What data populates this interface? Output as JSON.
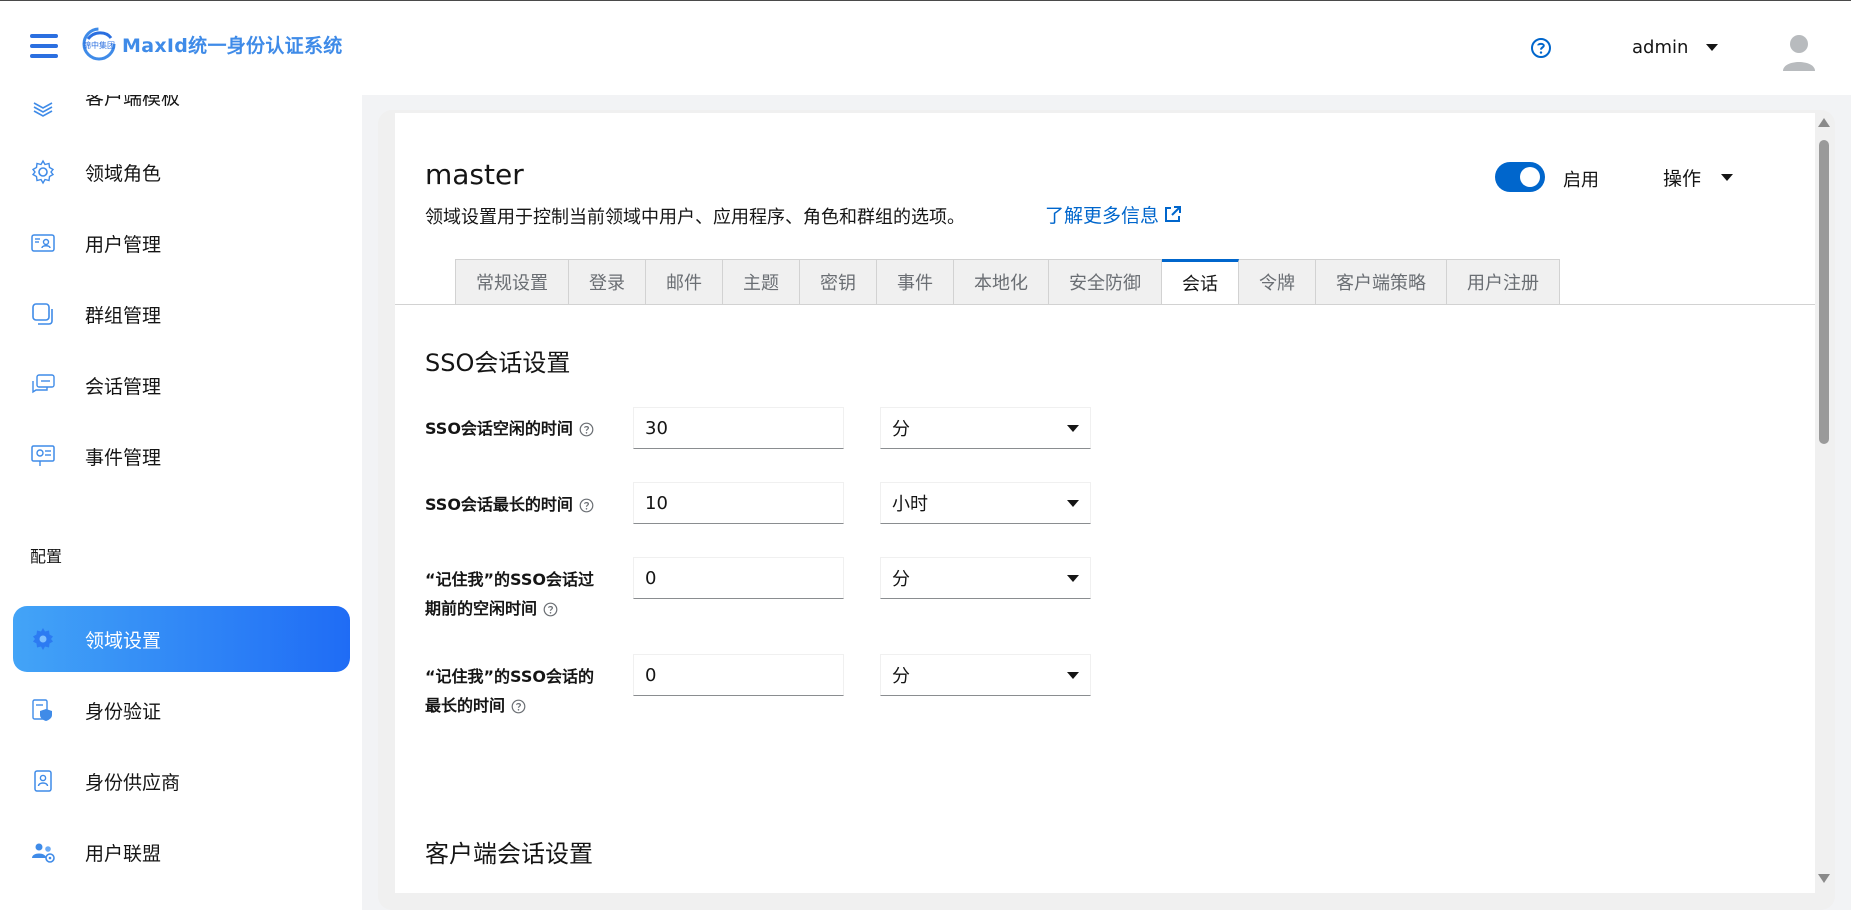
{
  "header": {
    "brand_mark": "锦中集团",
    "brand_title": "MaxId统一身份认证系统",
    "user_name": "admin"
  },
  "sidebar": {
    "items": [
      {
        "label": "客户端模板",
        "icon": "layers-icon"
      },
      {
        "label": "领域角色",
        "icon": "gear-icon"
      },
      {
        "label": "用户管理",
        "icon": "id-card-icon"
      },
      {
        "label": "群组管理",
        "icon": "copy-icon"
      },
      {
        "label": "会话管理",
        "icon": "chat-icon"
      },
      {
        "label": "事件管理",
        "icon": "monitor-icon"
      }
    ],
    "section_label": "配置",
    "config_items": [
      {
        "label": "领域设置",
        "icon": "gear-icon",
        "active": true
      },
      {
        "label": "身份验证",
        "icon": "shield-icon"
      },
      {
        "label": "身份供应商",
        "icon": "badge-icon"
      },
      {
        "label": "用户联盟",
        "icon": "users-icon"
      }
    ]
  },
  "realm": {
    "title": "master",
    "description": "领域设置用于控制当前领域中用户、应用程序、角色和群组的选项。",
    "learn_more": "了解更多信息",
    "enabled_label": "启用",
    "enabled": true,
    "actions_label": "操作"
  },
  "tabs": [
    "常规设置",
    "登录",
    "邮件",
    "主题",
    "密钥",
    "事件",
    "本地化",
    "安全防御",
    "会话",
    "令牌",
    "客户端策略",
    "用户注册"
  ],
  "active_tab": "会话",
  "sso_section": {
    "title": "SSO会话设置",
    "fields": [
      {
        "label_line1": "SSO会话空闲的时间",
        "label_line2": "",
        "value": "30",
        "unit": "分"
      },
      {
        "label_line1": "SSO会话最长的时间",
        "label_line2": "",
        "value": "10",
        "unit": "小时"
      },
      {
        "label_line1": "“记住我”的SSO会话过",
        "label_line2": "期前的空闲时间",
        "value": "0",
        "unit": "分"
      },
      {
        "label_line1": "“记住我”的SSO会话的",
        "label_line2": "最长的时间",
        "value": "0",
        "unit": "分"
      }
    ]
  },
  "client_section": {
    "title": "客户端会话设置"
  },
  "colors": {
    "accent": "#0066cc",
    "sidebar_active_start": "#43a4f7",
    "sidebar_active_end": "#1f6cf5",
    "brand": "#3f8be8"
  }
}
